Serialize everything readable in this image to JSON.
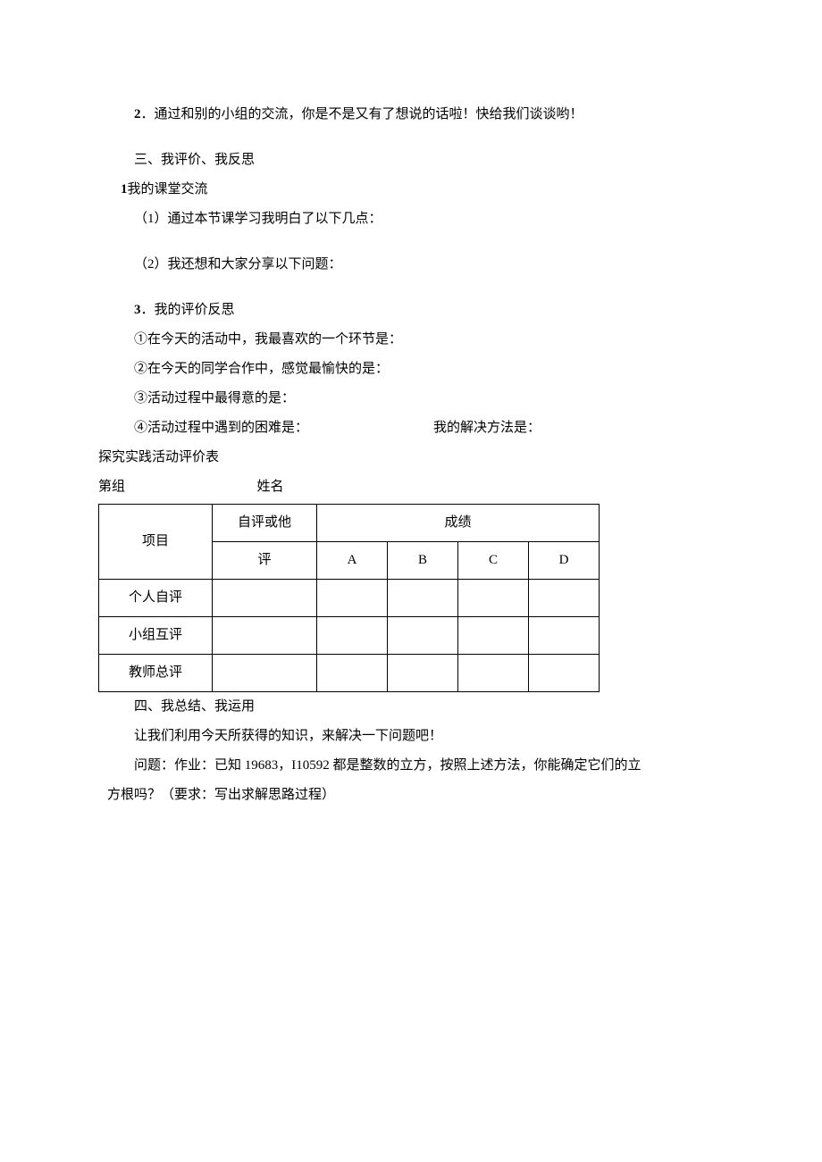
{
  "q2": {
    "num": "2",
    "text": "．通过和别的小组的交流，你是不是又有了想说的话啦！快给我们谈谈哟！"
  },
  "section3": {
    "heading": "三、我评价、我反思",
    "item1_num": "1",
    "item1_label": "我的课堂交流",
    "sub1": "（1）通过本节课学习我明白了以下几点：",
    "sub2": "（2）我还想和大家分享以下问题：",
    "item3_num": "3",
    "item3_label": "．我的评价反思",
    "line1": "①在今天的活动中，我最喜欢的一个环节是：",
    "line2": "②在今天的同学合作中，感觉最愉快的是：",
    "line3": "③活动过程中最得意的是：",
    "line4a": "④活动过程中遇到的困难是：",
    "line4b": "我的解决方法是："
  },
  "eval_table": {
    "title": "探究实践活动评价表",
    "group_prefix": "第组",
    "name_label": "姓名",
    "header_project": "项目",
    "header_eval_l1": "自评或他",
    "header_eval_l2": "评",
    "header_score": "成绩",
    "grades": [
      "A",
      "B",
      "C",
      "D"
    ],
    "rows": [
      "个人自评",
      "小组互评",
      "教师总评"
    ]
  },
  "section4": {
    "heading": "四、我总结、我运用",
    "line1": "让我们利用今天所获得的知识，来解决一下问题吧！",
    "line2a": "问题：作业：已知 19683，I10592 都是整数的立方，按照上述方法，你能确定它们的立",
    "line2b": "方根吗？（要求：写出求解思路过程）"
  }
}
